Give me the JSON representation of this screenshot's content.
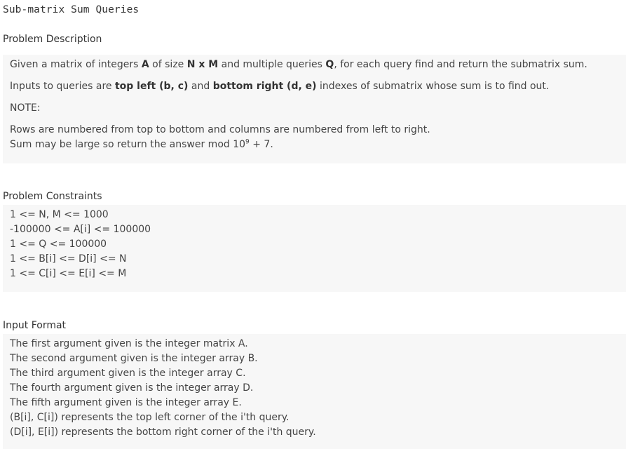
{
  "title": "Sub-matrix Sum Queries",
  "description": {
    "heading": "Problem Description",
    "line1": {
      "t1": "Given a matrix of integers ",
      "b1": "A",
      "t2": " of size ",
      "b2": "N x M",
      "t3": " and multiple queries ",
      "b3": "Q",
      "t4": ", for each query find and return the submatrix sum."
    },
    "line2": {
      "t1": "Inputs to queries are ",
      "b1": "top left (b, c)",
      "t2": " and ",
      "b2": "bottom right (d, e)",
      "t3": " indexes of submatrix whose sum is to find out."
    },
    "note_label": "NOTE:",
    "note_line1": "Rows are numbered from top to bottom and columns are numbered from left to right.",
    "note_line2": {
      "t1": "Sum may be large so return the answer mod 10",
      "sup": "9",
      "t2": " + 7."
    }
  },
  "constraints": {
    "heading": "Problem Constraints",
    "lines": [
      "1 <= N, M <= 1000",
      "-100000 <= A[i] <= 100000",
      "1 <= Q <= 100000",
      "1 <= B[i] <= D[i] <= N",
      "1 <= C[i] <= E[i] <= M"
    ]
  },
  "input_format": {
    "heading": "Input Format",
    "lines": [
      "The first argument given is the integer matrix A.",
      "The second argument given is the integer array B.",
      "The third argument given is the integer array C.",
      "The fourth argument given is the integer array D.",
      "The fifth argument given is the integer array E.",
      "(B[i], C[i]) represents the top left corner of the i'th query.",
      "(D[i], E[i]) represents the bottom right corner of the i'th query."
    ]
  }
}
